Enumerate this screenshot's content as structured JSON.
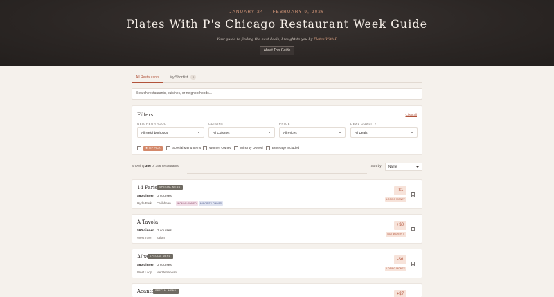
{
  "hero": {
    "dates": "JANUARY 24 — FEBRUARY 9, 2026",
    "title": "Plates With P's Chicago Restaurant Week Guide",
    "subtitle": "Your guide to finding the best deals, brought to you by",
    "brand": "Plates With P",
    "about_button": "About This Guide"
  },
  "tabs": [
    {
      "label": "All Restaurants",
      "active": true
    },
    {
      "label": "My Shortlist",
      "count": "0",
      "active": false
    }
  ],
  "search": {
    "placeholder": "Search restaurants, cuisines, or neighborhoods..."
  },
  "filters": {
    "title": "Filters",
    "clear_all": "Clear all",
    "neighborhood": {
      "label": "NEIGHBORHOOD",
      "value": "All Neighborhoods"
    },
    "cuisine": {
      "label": "CUISINE",
      "value": "All Cuisines"
    },
    "price": {
      "label": "PRICE",
      "value": "All Prices"
    },
    "deal_quality": {
      "label": "DEAL QUALITY",
      "value": "All Deals"
    },
    "checkboxes": {
      "vip": "★ VIP PICK",
      "special": "Special Menu Items",
      "women": "Women Owned",
      "minority": "Minority Owned",
      "beverage": "Beverage Included"
    }
  },
  "results": {
    "showing_prefix": "Showing",
    "shown": "356",
    "of_text": "of",
    "total": "356",
    "suffix": "restaurants",
    "sort_label": "Sort by:",
    "sort_value": "Name"
  },
  "restaurants": [
    {
      "name": "14 Parish",
      "special": "SPECIAL MENU",
      "price": "$60 dinner",
      "courses": "3 courses",
      "neighborhood": "Hyde Park",
      "cuisine": "Caribbean",
      "tags": [
        "WOMAN OWNED",
        "MINORITY OWNED"
      ],
      "savings": "-$1",
      "verdict": "LOSING MONEY"
    },
    {
      "name": "A Tavola",
      "special": "",
      "price": "$60 dinner",
      "courses": "3 courses",
      "neighborhood": "West Town",
      "cuisine": "Italian",
      "tags": [],
      "savings": "+$0",
      "verdict": "NOT WORTH IT"
    },
    {
      "name": "Alba",
      "special": "SPECIAL MENU",
      "price": "$60 dinner",
      "courses": "3 courses",
      "neighborhood": "West Loop",
      "cuisine": "Mediterranean",
      "tags": [],
      "savings": "-$6",
      "verdict": "LOSING MONEY"
    },
    {
      "name": "Acanto",
      "special": "SPECIAL MENU",
      "price": "",
      "courses": "",
      "neighborhood": "",
      "cuisine": "",
      "tags": [],
      "savings": "+$7",
      "verdict": ""
    }
  ],
  "colors": {
    "accent": "#b2533a",
    "hero_bg": "#2b2624",
    "page_bg": "#f5f1ec",
    "vip": "#d4896b"
  }
}
